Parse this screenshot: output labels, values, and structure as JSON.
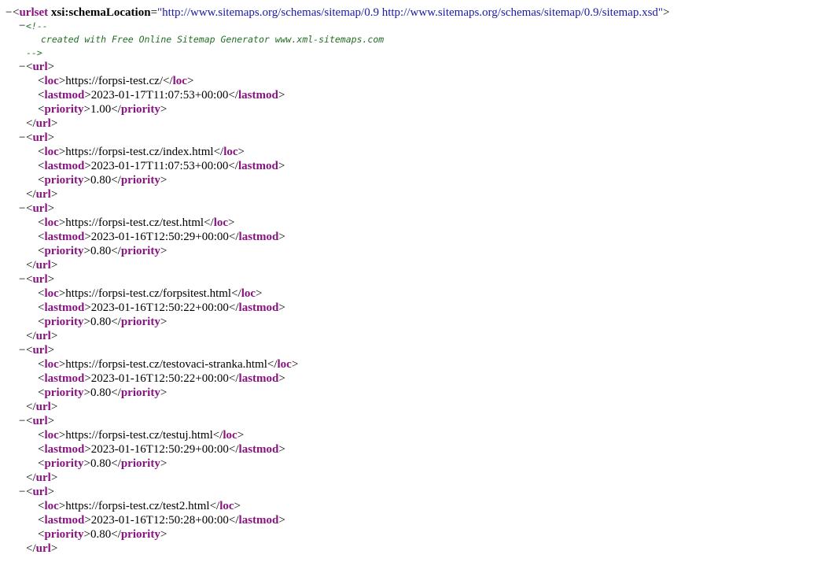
{
  "root": {
    "toggle": "−",
    "tag": "urlset",
    "attr_name": "xsi:schemaLocation",
    "attr_value": "\"http://www.sitemaps.org/schemas/sitemap/0.9 http://www.sitemaps.org/schemas/sitemap/0.9/sitemap.xsd\""
  },
  "comment": {
    "toggle": "−",
    "open": "<!--",
    "text": "created with Free Online Sitemap Generator www.xml-sitemaps.com",
    "close": "-->"
  },
  "entries": [
    {
      "loc": "https://forpsi-test.cz/",
      "lastmod": "2023-01-17T11:07:53+00:00",
      "priority": "1.00"
    },
    {
      "loc": "https://forpsi-test.cz/index.html",
      "lastmod": "2023-01-17T11:07:53+00:00",
      "priority": "0.80"
    },
    {
      "loc": "https://forpsi-test.cz/test.html",
      "lastmod": "2023-01-16T12:50:29+00:00",
      "priority": "0.80"
    },
    {
      "loc": "https://forpsi-test.cz/forpsitest.html",
      "lastmod": "2023-01-16T12:50:22+00:00",
      "priority": "0.80"
    },
    {
      "loc": "https://forpsi-test.cz/testovaci-stranka.html",
      "lastmod": "2023-01-16T12:50:22+00:00",
      "priority": "0.80"
    },
    {
      "loc": "https://forpsi-test.cz/testuj.html",
      "lastmod": "2023-01-16T12:50:29+00:00",
      "priority": "0.80"
    },
    {
      "loc": "https://forpsi-test.cz/test2.html",
      "lastmod": "2023-01-16T12:50:28+00:00",
      "priority": "0.80"
    }
  ],
  "labels": {
    "url_tag": "url",
    "loc_tag": "loc",
    "lastmod_tag": "lastmod",
    "priority_tag": "priority",
    "toggle": "−"
  },
  "colors": {
    "tag": "#881280",
    "attr_value": "#1a1aa6",
    "comment": "#236e25"
  }
}
